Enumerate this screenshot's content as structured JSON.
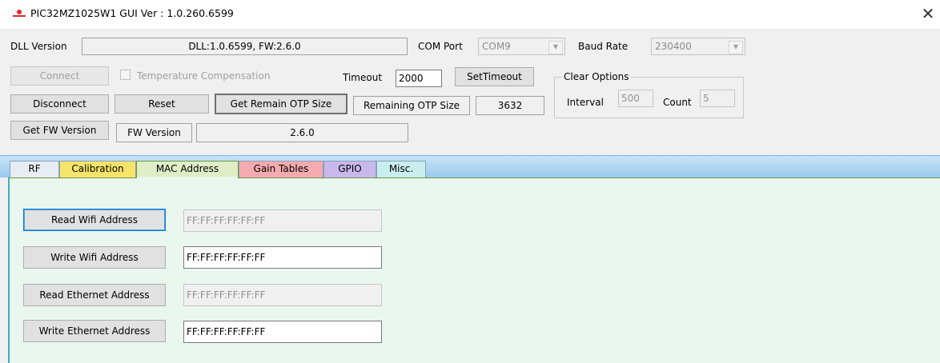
{
  "window": {
    "title": "PIC32MZ1025W1 GUI Ver : 1.0.260.6599",
    "icon": "app-logo-icon",
    "close_glyph": "✕"
  },
  "top": {
    "dll_label": "DLL Version",
    "dll_value": "DLL:1.0.6599, FW:2.6.0",
    "com_label": "COM Port",
    "com_value": "COM9",
    "baud_label": "Baud Rate",
    "baud_value": "230400",
    "connect": "Connect",
    "temp_comp": "Temperature Compensation",
    "timeout_label": "Timeout",
    "timeout_value": "2000",
    "set_timeout": "SetTimeout",
    "disconnect": "Disconnect",
    "reset": "Reset",
    "get_remain_otp": "Get Remain OTP Size",
    "remaining_otp_label": "Remaining OTP Size",
    "remaining_otp_value": "3632",
    "get_fw": "Get FW Version",
    "fw_label": "FW Version",
    "fw_value": "2.6.0"
  },
  "clear_options": {
    "title": "Clear Options",
    "interval_label": "Interval",
    "interval_value": "500",
    "count_label": "Count",
    "count_value": "5"
  },
  "tabs": [
    {
      "label": "RF"
    },
    {
      "label": "Calibration"
    },
    {
      "label": "MAC Address",
      "active": true
    },
    {
      "label": "Gain Tables"
    },
    {
      "label": "GPIO"
    },
    {
      "label": "Misc."
    }
  ],
  "mac": {
    "read_wifi": "Read Wifi Address",
    "read_wifi_value": "FF:FF:FF:FF:FF:FF",
    "write_wifi": "Write Wifi Address",
    "write_wifi_value": "FF:FF:FF:FF:FF:FF",
    "read_eth": "Read Ethernet Address",
    "read_eth_value": "FF:FF:FF:FF:FF:FF",
    "write_eth": "Write Ethernet Address",
    "write_eth_value": "FF:FF:FF:FF:FF:FF"
  },
  "colors": {
    "tab_rf": "#e8ecf4",
    "tab_calibration": "#f6e46a",
    "tab_mac": "#dfeec6",
    "tab_gain": "#f4aab0",
    "tab_gpio": "#c9b8ec",
    "tab_misc": "#c8eef0",
    "page_bg": "#e9f7ef",
    "tabstrip": "#9cc9ec"
  }
}
